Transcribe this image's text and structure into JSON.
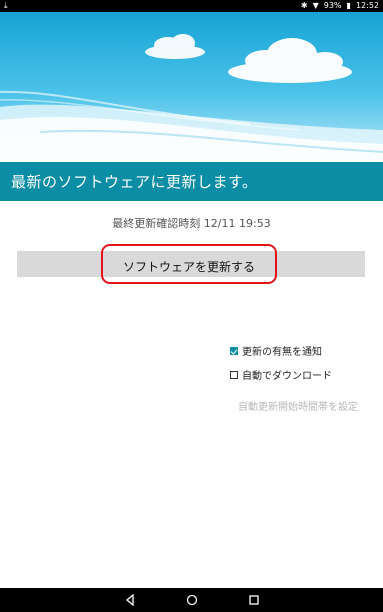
{
  "status_bar": {
    "left_icon": "download-icon",
    "battery": "93%",
    "time": "12:52",
    "icons": [
      "bluetooth-icon",
      "wifi-icon",
      "battery-icon"
    ]
  },
  "header": {
    "title": "最新のソフトウェアに更新します。"
  },
  "main": {
    "last_update": "最終更新確認時刻 12/11 19:53",
    "update_button_label": "ソフトウェアを更新する",
    "options": [
      {
        "label": "更新の有無を通知",
        "checked": true
      },
      {
        "label": "自動でダウンロード",
        "checked": false
      }
    ],
    "schedule_link": "自動更新開始時間帯を設定"
  },
  "nav": {
    "buttons": [
      "back-icon",
      "home-icon",
      "recents-icon"
    ]
  },
  "colors": {
    "accent": "#0b8ea5",
    "highlight": "#e3141b",
    "button_bg": "#d9d9d9"
  }
}
